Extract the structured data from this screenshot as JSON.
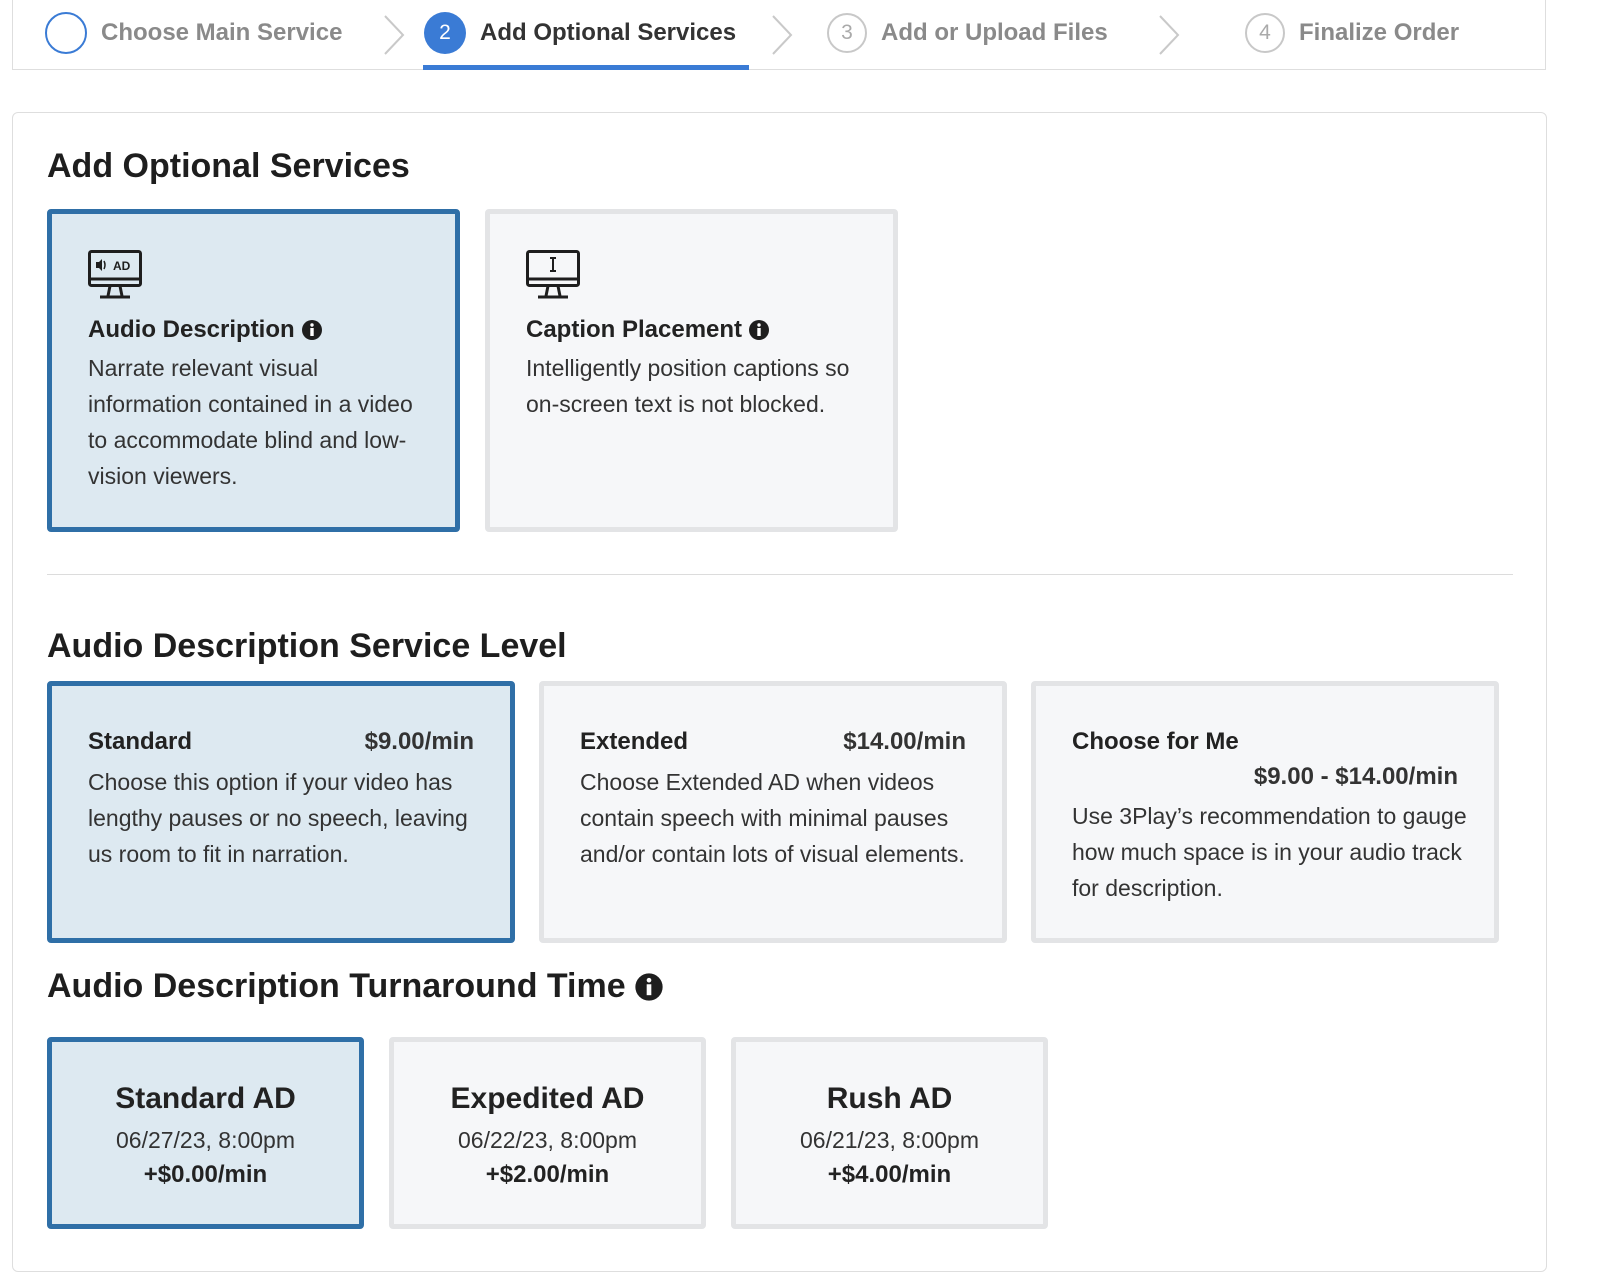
{
  "stepper": {
    "steps": [
      {
        "number": "",
        "label": "Choose Main Service"
      },
      {
        "number": "2",
        "label": "Add Optional Services"
      },
      {
        "number": "3",
        "label": "Add or Upload Files"
      },
      {
        "number": "4",
        "label": "Finalize Order"
      }
    ],
    "active_step": 2
  },
  "optional_services": {
    "heading": "Add Optional Services",
    "cards": [
      {
        "icon": "monitor-ad-icon",
        "icon_text": "AD",
        "title": "Audio Description",
        "description": "Narrate relevant visual information contained in a video to accommodate blind and low-vision viewers.",
        "selected": true
      },
      {
        "icon": "monitor-caption-icon",
        "title": "Caption Placement",
        "description": "Intelligently position captions so on-screen text is not blocked.",
        "selected": false
      }
    ]
  },
  "service_level": {
    "heading": "Audio Description Service Level",
    "options": [
      {
        "title": "Standard",
        "price": "$9.00/min",
        "description": "Choose this option if your video has lengthy pauses or no speech, leaving us room to fit in narration.",
        "selected": true
      },
      {
        "title": "Extended",
        "price": "$14.00/min",
        "description": "Choose Extended AD when videos contain speech with minimal pauses and/or contain lots of visual elements.",
        "selected": false
      },
      {
        "title": "Choose for Me",
        "price": "$9.00 - $14.00/min",
        "description": "Use 3Play’s recommendation to gauge how much space is in your audio track for description.",
        "selected": false
      }
    ]
  },
  "turnaround": {
    "heading": "Audio Description Turnaround Time",
    "options": [
      {
        "name": "Standard AD",
        "date": "06/27/23, 8:00pm",
        "price": "+$0.00/min",
        "selected": true
      },
      {
        "name": "Expedited AD",
        "date": "06/22/23, 8:00pm",
        "price": "+$2.00/min",
        "selected": false
      },
      {
        "name": "Rush AD",
        "date": "06/21/23, 8:00pm",
        "price": "+$4.00/min",
        "selected": false
      }
    ]
  },
  "colors": {
    "accent": "#3a7bd5",
    "selected_border": "#2f6fa7",
    "selected_bg": "#dde9f1",
    "card_bg": "#f6f7f9"
  }
}
